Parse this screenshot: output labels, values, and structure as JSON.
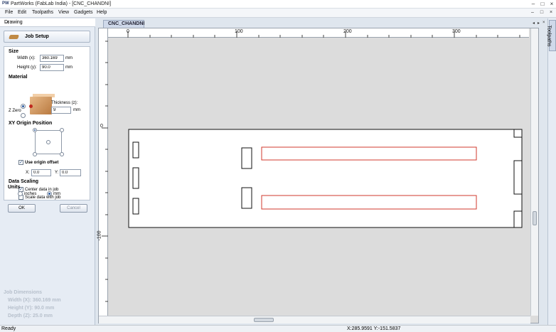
{
  "app": {
    "logo": "PW",
    "title": "PartWorks (FabLab India) - [CNC_CHANDNI]",
    "window_controls": [
      "–",
      "□",
      "×"
    ]
  },
  "menu": {
    "items": [
      "File",
      "Edit",
      "Toolpaths",
      "View",
      "Gadgets",
      "Help"
    ],
    "doc_controls": [
      "–",
      "□",
      "×"
    ]
  },
  "drawing_panel": {
    "header": "Drawing",
    "pin_icon": "pin-icon",
    "job_setup_label": "Job Setup",
    "size": {
      "section": "Size",
      "width_label": "Width (x):",
      "width_value": "360.169",
      "width_unit": "mm",
      "height_label": "Height (y):",
      "height_value": "90.0",
      "height_unit": "mm"
    },
    "material": {
      "section": "Material",
      "zzero_label": "Z Zero",
      "thickness_label": "Thickness (z):",
      "thickness_value": "9",
      "thickness_unit": "mm"
    },
    "xy_origin": {
      "section": "XY Origin Position",
      "use_offset_label": "Use origin offset",
      "use_offset_checked": true,
      "x_label": "X:",
      "x_value": "0.0",
      "y_label": "Y:",
      "y_value": "0.0"
    },
    "data_scaling": {
      "section": "Data Scaling",
      "center_label": "Center data in job",
      "center_checked": true,
      "scale_label": "Scale data with job",
      "scale_checked": false
    },
    "units": {
      "section": "Units",
      "inches_label": "inches",
      "mm_label": "mm",
      "selected": "mm"
    },
    "ok_label": "OK",
    "cancel_label": "Cancel",
    "job_dimensions": {
      "title": "Job Dimensions",
      "width": "Width  (X): 360.169 mm",
      "height": "Height (Y): 90.0 mm",
      "depth": "Depth  (Z): 25.0 mm"
    }
  },
  "document": {
    "tab_label": "CNC_CHANDNI",
    "tab_controls": [
      "◂",
      "▸",
      "×"
    ],
    "ruler_top": [
      "0",
      "100",
      "200",
      "300"
    ],
    "ruler_left": [
      "0",
      "-100"
    ]
  },
  "toolpaths_tab": "Toolpaths",
  "status": {
    "left": "Ready",
    "coords": "X:285.9591 Y:-151.5837"
  },
  "colors": {
    "vector_selected": "#d13a2e",
    "vector_default": "#222222",
    "accent": "#2b5a9e"
  }
}
